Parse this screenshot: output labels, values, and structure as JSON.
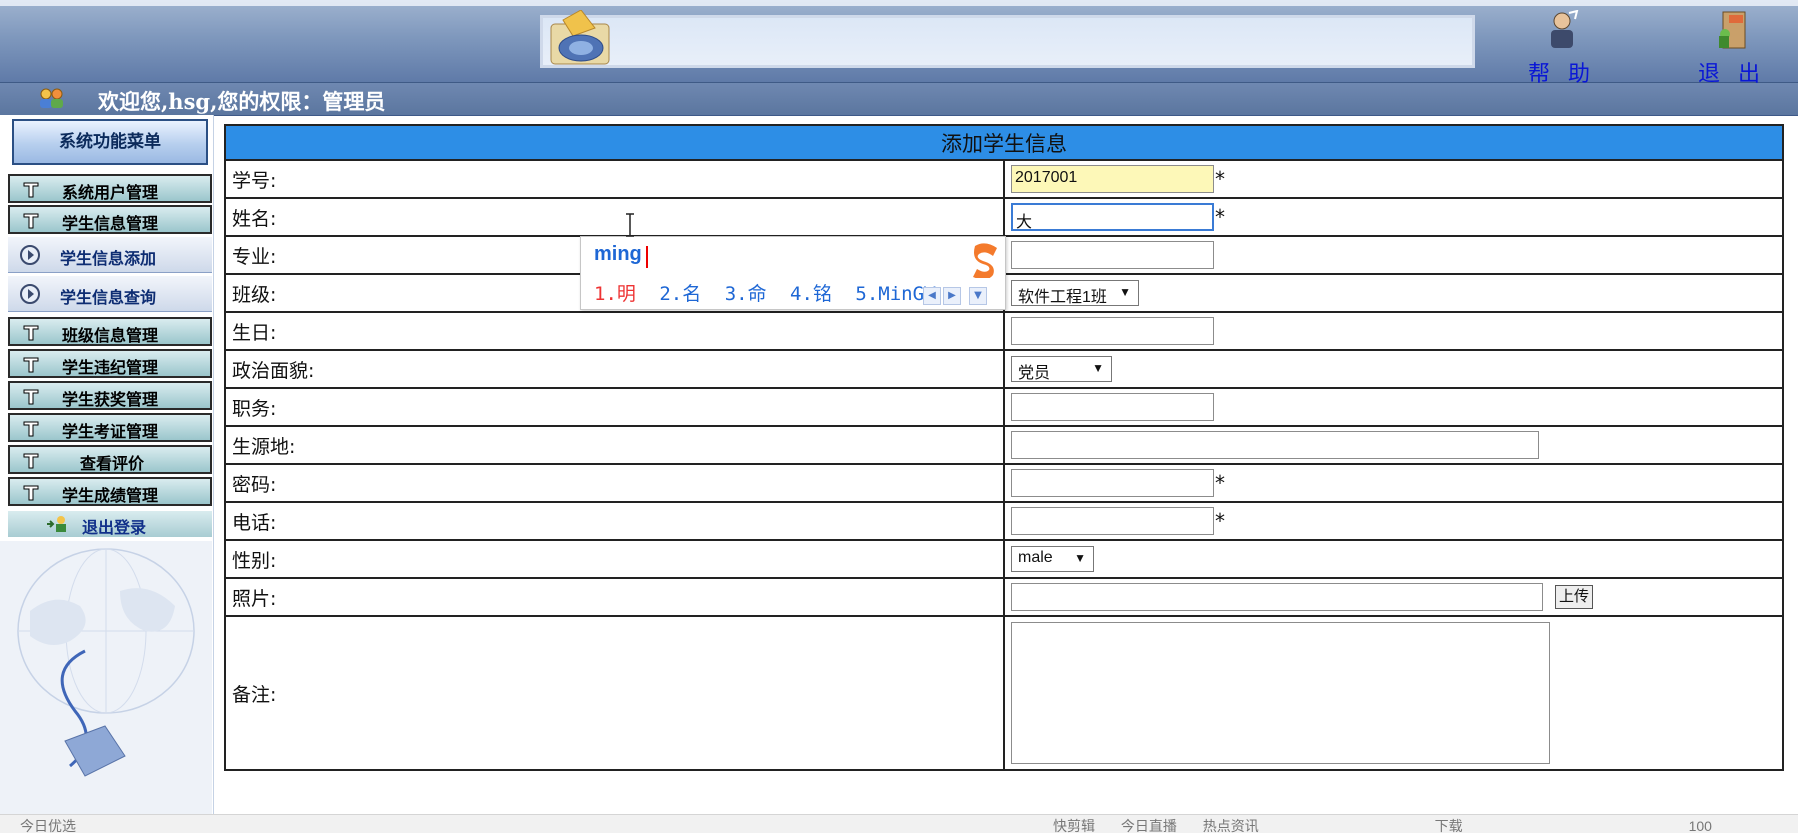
{
  "header": {
    "help_label": "帮 助",
    "exit_label": "退 出"
  },
  "welcome": {
    "text": "欢迎您,hsg,您的权限：管理员"
  },
  "sidebar": {
    "title": "系统功能菜单",
    "items": [
      {
        "label": "系统用户管理"
      },
      {
        "label": "学生信息管理"
      },
      {
        "label": "学生信息添加"
      },
      {
        "label": "学生信息查询"
      },
      {
        "label": "班级信息管理"
      },
      {
        "label": "学生违纪管理"
      },
      {
        "label": "学生获奖管理"
      },
      {
        "label": "学生考证管理"
      },
      {
        "label": "查看评价"
      },
      {
        "label": "学生成绩管理"
      }
    ],
    "logout_label": "退出登录"
  },
  "form": {
    "title": "添加学生信息",
    "fields": {
      "student_id": {
        "label": "学号:",
        "value": "2017001"
      },
      "name": {
        "label": "姓名:",
        "value": "大"
      },
      "major": {
        "label": "专业:",
        "value": ""
      },
      "class": {
        "label": "班级:",
        "value": "软件工程1班"
      },
      "birthday": {
        "label": "生日:",
        "value": ""
      },
      "political": {
        "label": "政治面貌:",
        "value": "党员"
      },
      "position": {
        "label": "职务:",
        "value": ""
      },
      "origin": {
        "label": "生源地:",
        "value": ""
      },
      "password": {
        "label": "密码:",
        "value": ""
      },
      "phone": {
        "label": "电话:",
        "value": ""
      },
      "gender": {
        "label": "性别:",
        "value": "male"
      },
      "photo": {
        "label": "照片:",
        "value": "",
        "upload_label": "上传"
      },
      "remarks": {
        "label": "备注:",
        "value": ""
      }
    },
    "required_mark": "*"
  },
  "ime": {
    "pinyin": "ming",
    "candidates": [
      "1.明",
      "2.名",
      "3.命",
      "4.铭",
      "5.MinGW"
    ]
  },
  "statusbar": {
    "left": "今日优选",
    "right_items": [
      "快剪辑",
      "今日直播",
      "热点资讯",
      "下载",
      "100"
    ]
  }
}
